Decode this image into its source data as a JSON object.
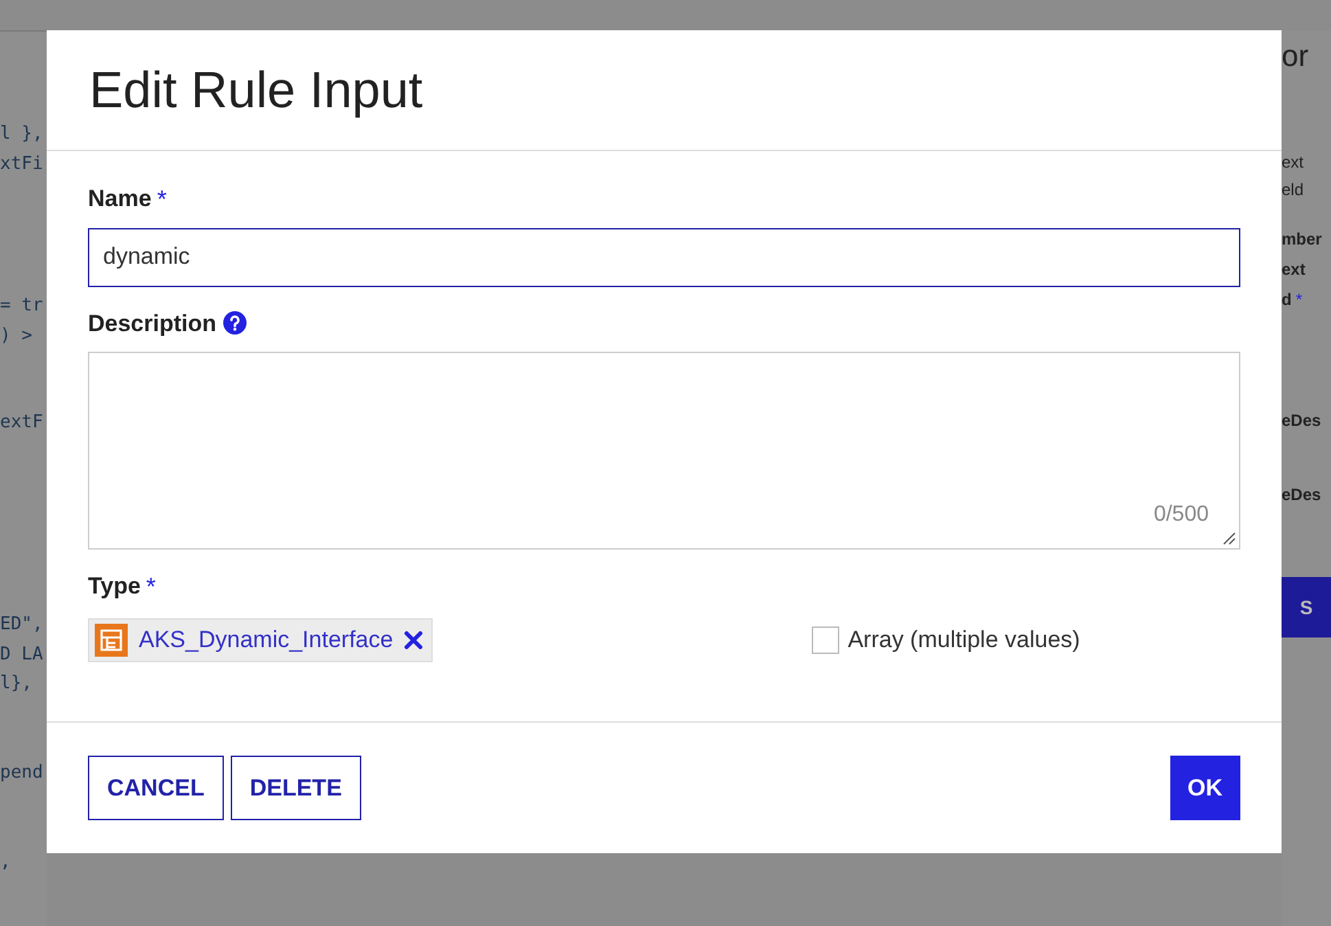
{
  "background": {
    "code_fragments": [
      "l },",
      "xtFi",
      "= tr",
      ") >",
      "extF",
      "ED\",",
      "D LA",
      "l},",
      "pend",
      ","
    ],
    "side_panel": {
      "heading": "or",
      "labels": [
        {
          "text": "ext",
          "bold": false
        },
        {
          "text": "eld",
          "bold": false
        },
        {
          "text": "mber",
          "bold": true
        },
        {
          "text": "ext",
          "bold": true
        },
        {
          "text": "d",
          "bold": true,
          "required_mark": "*"
        },
        {
          "text": "eDes",
          "bold": true
        },
        {
          "text": "eDes",
          "bold": true
        }
      ],
      "button": "S"
    }
  },
  "dialog": {
    "title": "Edit Rule Input",
    "fields": [
      {
        "kind": "text",
        "label": "Name",
        "required_mark": "*",
        "value": "dynamic"
      },
      {
        "kind": "textarea",
        "label": "Description",
        "help": true,
        "counter": "0/500"
      },
      {
        "kind": "type",
        "label": "Type",
        "required_mark": "*",
        "token": "AKS_Dynamic_Interface",
        "array": {
          "label": "Array (multiple values)",
          "checked": false
        }
      }
    ],
    "buttons": [
      {
        "label": "CANCEL",
        "primary": false
      },
      {
        "label": "DELETE",
        "primary": false
      },
      {
        "label": "OK",
        "primary": true
      }
    ]
  }
}
